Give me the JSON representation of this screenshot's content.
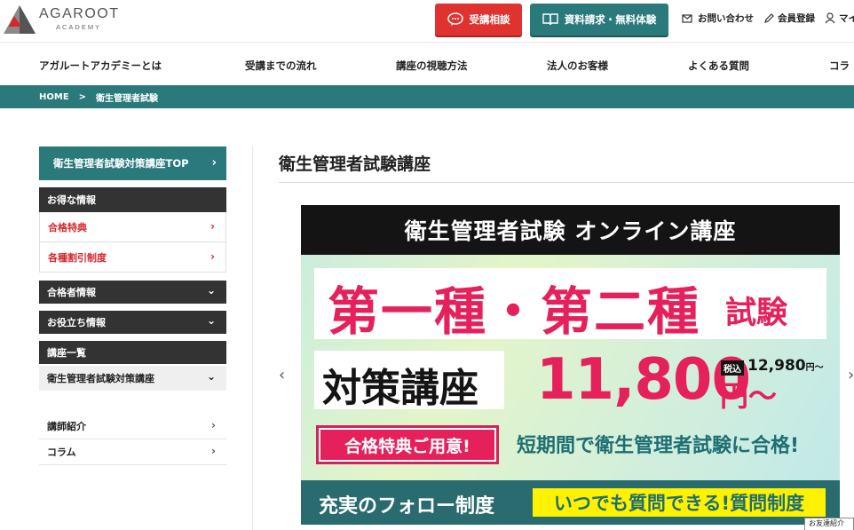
{
  "header": {
    "logo_text": "AGAROOT",
    "logo_sub": "ACADEMY",
    "consult_button": "受講相談",
    "docs_button": "資料請求・無料体験",
    "contact_link": "お問い合わせ",
    "register_link": "会員登録",
    "mypage_link": "マイ"
  },
  "gnav": {
    "items": [
      "アガルートアカデミーとは",
      "受講までの流れ",
      "講座の視聴方法",
      "法人のお客様",
      "よくある質問",
      "コラ"
    ]
  },
  "breadcrumb": {
    "home": "HOME",
    "separator": ">",
    "current": "衛生管理者試験"
  },
  "sidebar": {
    "top": "衛生管理者試験対策講座TOP",
    "deals_heading": "お得な情報",
    "deals": [
      "合格特典",
      "各種割引制度"
    ],
    "passers_heading": "合格者情報",
    "useful_heading": "お役立ち情報",
    "courses_heading": "講座一覧",
    "course_item": "衛生管理者試験対策講座",
    "instructors": "講師紹介",
    "column": "コラム"
  },
  "main": {
    "title": "衛生管理者試験講座"
  },
  "banner": {
    "top": "衛生管理者試験 オンライン講座",
    "kinds": "第一種・第二種",
    "exam": "試験",
    "course": "対策講座",
    "price": "11,800",
    "yen": "円〜",
    "tax_label": "税込",
    "tax_price": "12,980",
    "tax_suffix": "円〜",
    "benefit": "合格特典ご用意!",
    "pass": "短期間で衛生管理者試験に合格!",
    "follow": "充実のフォロー制度",
    "question": "いつでも質問できる!質問制度"
  },
  "floating": {
    "label": "お友達紹介"
  },
  "colors": {
    "teal": "#2a7a7c",
    "red": "#e0322e",
    "pink": "#e5205a",
    "dark": "#333333"
  }
}
